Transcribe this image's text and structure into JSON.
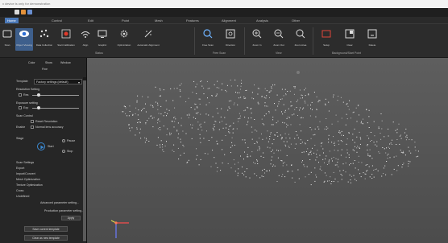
{
  "window": {
    "title": "x device is only for demonstration"
  },
  "menu": [
    "Home",
    "Control",
    "Edit",
    "Point",
    "Mesh",
    "Features",
    "Alignment",
    "Analysis",
    "Other"
  ],
  "ribbon": {
    "buttons": [
      "Scan",
      "Object Viewing",
      "Data Collection",
      "Start Calibration",
      "Align",
      "Graphic",
      "Optimization",
      "Automatic Alignment",
      "Free Scan",
      "Direction",
      "Zoom In",
      "Zoom Out",
      "Zoom Area",
      "Setup",
      "Clear",
      "Delete"
    ],
    "groups": [
      "Status",
      "Free Scan",
      "View",
      "Background/Start Point"
    ]
  },
  "panel": {
    "tabs": [
      "Color",
      "Show",
      "Window"
    ],
    "subtitle": "Fine",
    "template_label": "Template",
    "template_value": "Factory settings (default)",
    "resolution_label": "Resolution Setting",
    "res_chk": "Res",
    "exposure_label": "Exposure setting",
    "exp_chk": "Exp",
    "scan_control": "Scan Control",
    "reset_cam": "Reset Resolution",
    "normal_lens": "Normal lens accuracy",
    "enable_label": "Enable",
    "stage_label": "Stage",
    "start_label": "Start",
    "pause_label": "Pause",
    "stop_label": "Stop",
    "scan_settings": "Scan Settings",
    "list": [
      "Export",
      "Import/Convert",
      "Mesh Optimization",
      "Texture Optimization",
      "Cross",
      "Undefined"
    ],
    "adv_btn": "Advanced parameter setting...",
    "prod_btn": "Production parameter setting...",
    "apply_btn": "Apply",
    "save_btn": "Save current template",
    "reset_btn": "Clear as new template"
  }
}
